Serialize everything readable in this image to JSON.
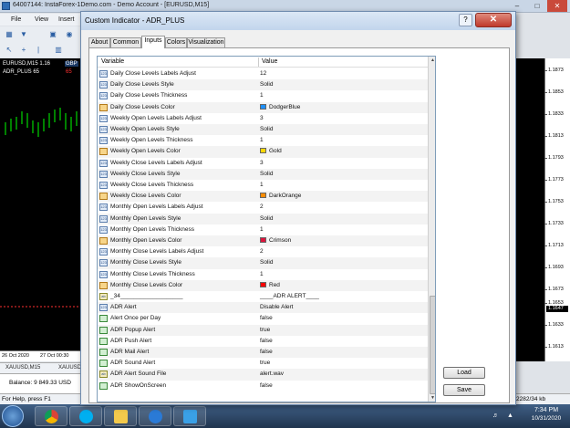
{
  "app": {
    "window_title": "64007144: InstaForex-1Demo.com - Demo Account - [EURUSD,M15]",
    "menu": [
      "File",
      "View",
      "Insert"
    ],
    "chart": {
      "symbol_label": "EURUSD,M15  1.16",
      "indicator_label": "ADR_PLUS 65",
      "badge_gbp": "GBP",
      "badge_num": "65",
      "time_labels": [
        "26 Oct 2020",
        "27 Oct 00:30"
      ],
      "tabs": [
        "XAUUSD,M15",
        "XAUUSD"
      ],
      "prices": [
        "1.1873",
        "1.1853",
        "1.1833",
        "1.1813",
        "1.1793",
        "1.1773",
        "1.1753",
        "1.1733",
        "1.1713",
        "1.1693",
        "1.1673",
        "1.1653",
        "1.1633",
        "1.1613"
      ],
      "current_price": "1.1647"
    },
    "terminal_balance": "Balance: 9 849.33 USD",
    "status_left": "For Help, press F1",
    "status_right": "2282/34 kb",
    "clock_time": "7:34 PM",
    "clock_date": "10/31/2020"
  },
  "dialog": {
    "title": "Custom Indicator - ADR_PLUS",
    "help_label": "?",
    "close_label": "✕",
    "tabs": [
      "About",
      "Common",
      "Inputs",
      "Colors",
      "Visualization"
    ],
    "active_tab": "Inputs",
    "grid_header": {
      "variable": "Variable",
      "value": "Value"
    },
    "rows": [
      {
        "icon": "int",
        "name": "Daily Close Levels Labels Adjust",
        "value": "12"
      },
      {
        "icon": "int",
        "name": "Daily Close Levels Style",
        "value": "Solid"
      },
      {
        "icon": "int",
        "name": "Daily Close Levels Thickness",
        "value": "1"
      },
      {
        "icon": "color",
        "name": "Daily Close Levels Color",
        "value": "DodgerBlue",
        "swatch": "#1e90ff"
      },
      {
        "icon": "int",
        "name": "Weekly Open Levels Labels Adjust",
        "value": "3"
      },
      {
        "icon": "int",
        "name": "Weekly Open Levels Style",
        "value": "Solid"
      },
      {
        "icon": "int",
        "name": "Weekly Open Levels Thickness",
        "value": "1"
      },
      {
        "icon": "color",
        "name": "Weekly Open Levels Color",
        "value": "Gold",
        "swatch": "#ffd700"
      },
      {
        "icon": "int",
        "name": "Weekly Close Levels Labels Adjust",
        "value": "3"
      },
      {
        "icon": "int",
        "name": "Weekly Close Levels Style",
        "value": "Solid"
      },
      {
        "icon": "int",
        "name": "Weekly Close Levels Thickness",
        "value": "1"
      },
      {
        "icon": "color",
        "name": "Weekly Close Levels Color",
        "value": "DarkOrange",
        "swatch": "#ff8c00"
      },
      {
        "icon": "int",
        "name": "Monthly Open Levels Labels Adjust",
        "value": "2"
      },
      {
        "icon": "int",
        "name": "Monthly Open Levels Style",
        "value": "Solid"
      },
      {
        "icon": "int",
        "name": "Monthly Open Levels Thickness",
        "value": "1"
      },
      {
        "icon": "color",
        "name": "Monthly Open Levels Color",
        "value": "Crimson",
        "swatch": "#dc143c"
      },
      {
        "icon": "int",
        "name": "Monthly Close Levels Labels Adjust",
        "value": "2"
      },
      {
        "icon": "int",
        "name": "Monthly Close Levels Style",
        "value": "Solid"
      },
      {
        "icon": "int",
        "name": "Monthly Close Levels Thickness",
        "value": "1"
      },
      {
        "icon": "color",
        "name": "Monthly Close Levels Color",
        "value": "Red",
        "swatch": "#ff0000"
      },
      {
        "icon": "str",
        "name": "_34___________________",
        "value": "____ADR ALERT____"
      },
      {
        "icon": "int",
        "name": "ADR Alert",
        "value": "Disable Alert"
      },
      {
        "icon": "bool",
        "name": "Alert Once per Day",
        "value": "false"
      },
      {
        "icon": "bool",
        "name": "ADR Popup Alert",
        "value": "true"
      },
      {
        "icon": "bool",
        "name": "ADR Push Alert",
        "value": "false"
      },
      {
        "icon": "bool",
        "name": "ADR Mail Alert",
        "value": "false"
      },
      {
        "icon": "bool",
        "name": "ADR Sound Alert",
        "value": "true"
      },
      {
        "icon": "str",
        "name": "ADR Alert Sound File",
        "value": "alert.wav"
      },
      {
        "icon": "bool",
        "name": "ADR ShowOnScreen",
        "value": "false"
      }
    ],
    "buttons": {
      "load": "Load",
      "save": "Save"
    }
  }
}
